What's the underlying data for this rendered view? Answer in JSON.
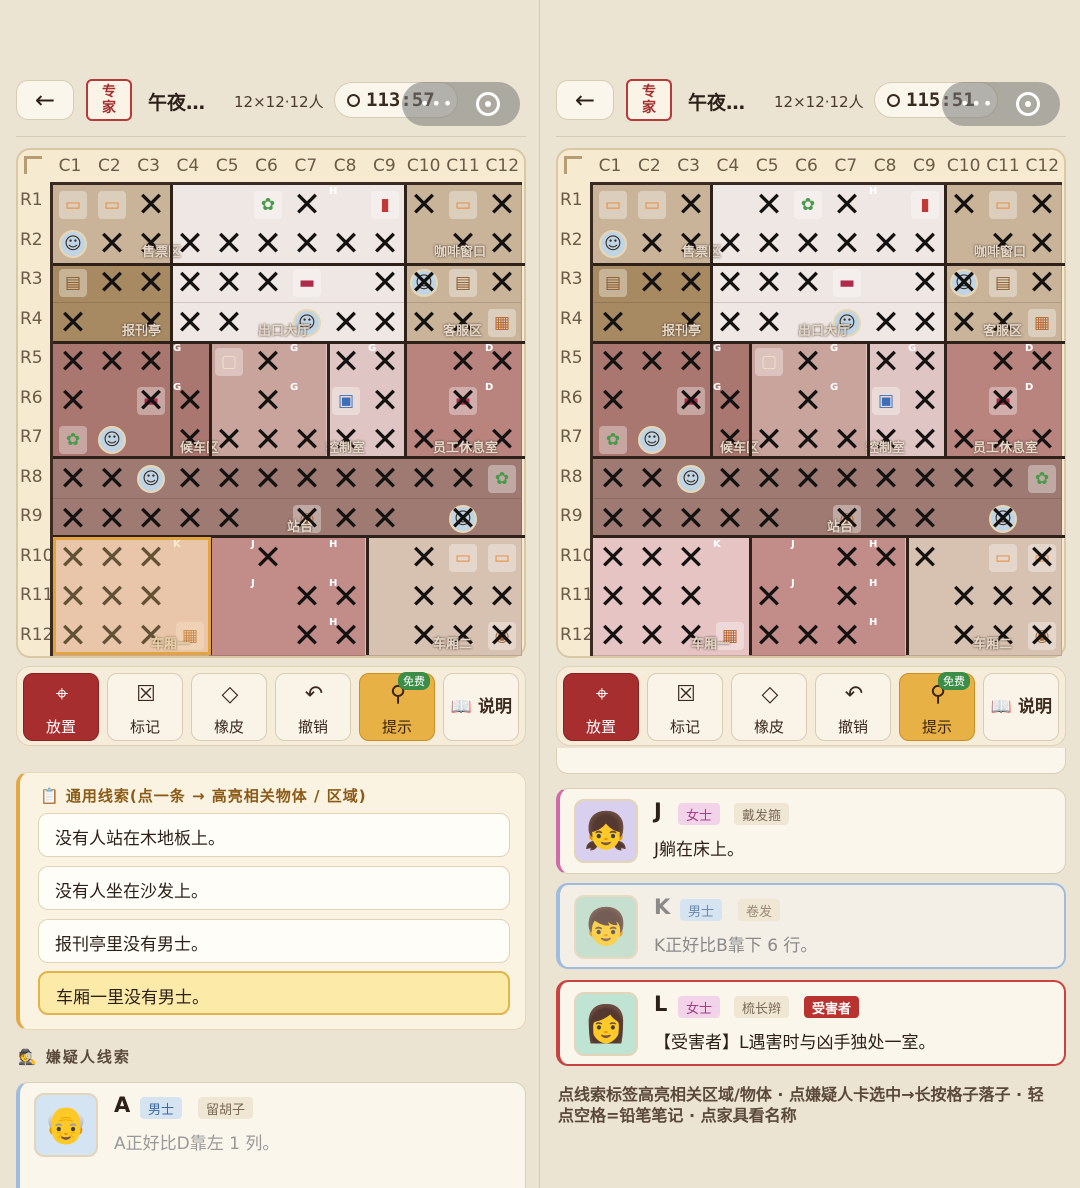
{
  "header": {
    "badge": "专\n家",
    "title": "午夜…",
    "grid_info": "12×12·12人",
    "left_timer": "113:57",
    "right_timer": "115:51",
    "back_icon": "←"
  },
  "board": {
    "columns": [
      "C1",
      "C2",
      "C3",
      "C4",
      "C5",
      "C6",
      "C7",
      "C8",
      "C9",
      "C10",
      "C11",
      "C12"
    ],
    "rows": [
      "R1",
      "R2",
      "R3",
      "R4",
      "R5",
      "R6",
      "R7",
      "R8",
      "R9",
      "R10",
      "R11",
      "R12"
    ],
    "regions": [
      "售票区",
      "咖啡窗口",
      "报刊亭",
      "出口大厅",
      "客服区",
      "候车区",
      "控制室",
      "员工休息室",
      "站台",
      "车厢一",
      "车厢二"
    ]
  },
  "toolbar": {
    "place": "放置",
    "mark": "标记",
    "eraser": "橡皮",
    "undo": "撤销",
    "hint": "提示",
    "hint_badge": "免费",
    "help": "说明"
  },
  "clues": {
    "heading": "通用线索(点一条 → 高亮相关物体 / 区域)",
    "items": [
      "没有人站在木地板上。",
      "没有人坐在沙发上。",
      "报刊亭里没有男士。",
      "车厢一里没有男士。"
    ]
  },
  "suspects_heading": "嫌疑人线索",
  "suspect_a": {
    "name": "A",
    "gender": "男士",
    "trait": "留胡子",
    "text": "A正好比D靠左 1 列。"
  },
  "suspect_j": {
    "name": "J",
    "gender": "女士",
    "trait": "戴发箍",
    "text": "J躺在床上。"
  },
  "suspect_k": {
    "name": "K",
    "gender": "男士",
    "trait": "卷发",
    "text": "K正好比B靠下 6 行。"
  },
  "suspect_l": {
    "name": "L",
    "gender": "女士",
    "trait": "梳长辫",
    "victim": "受害者",
    "text": "【受害者】L遇害时与凶手独处一室。"
  },
  "instructions": "点线索标签高亮相关区域/物体 · 点嫌疑人卡选中→长按格子落子 · 轻点空格=铅笔笔记 · 点家具看名称",
  "colors": {
    "accent_red": "#a62e2e",
    "gold": "#e8b145",
    "female_tag": "#f3d3ea",
    "male_tag": "#d6e4f2"
  }
}
